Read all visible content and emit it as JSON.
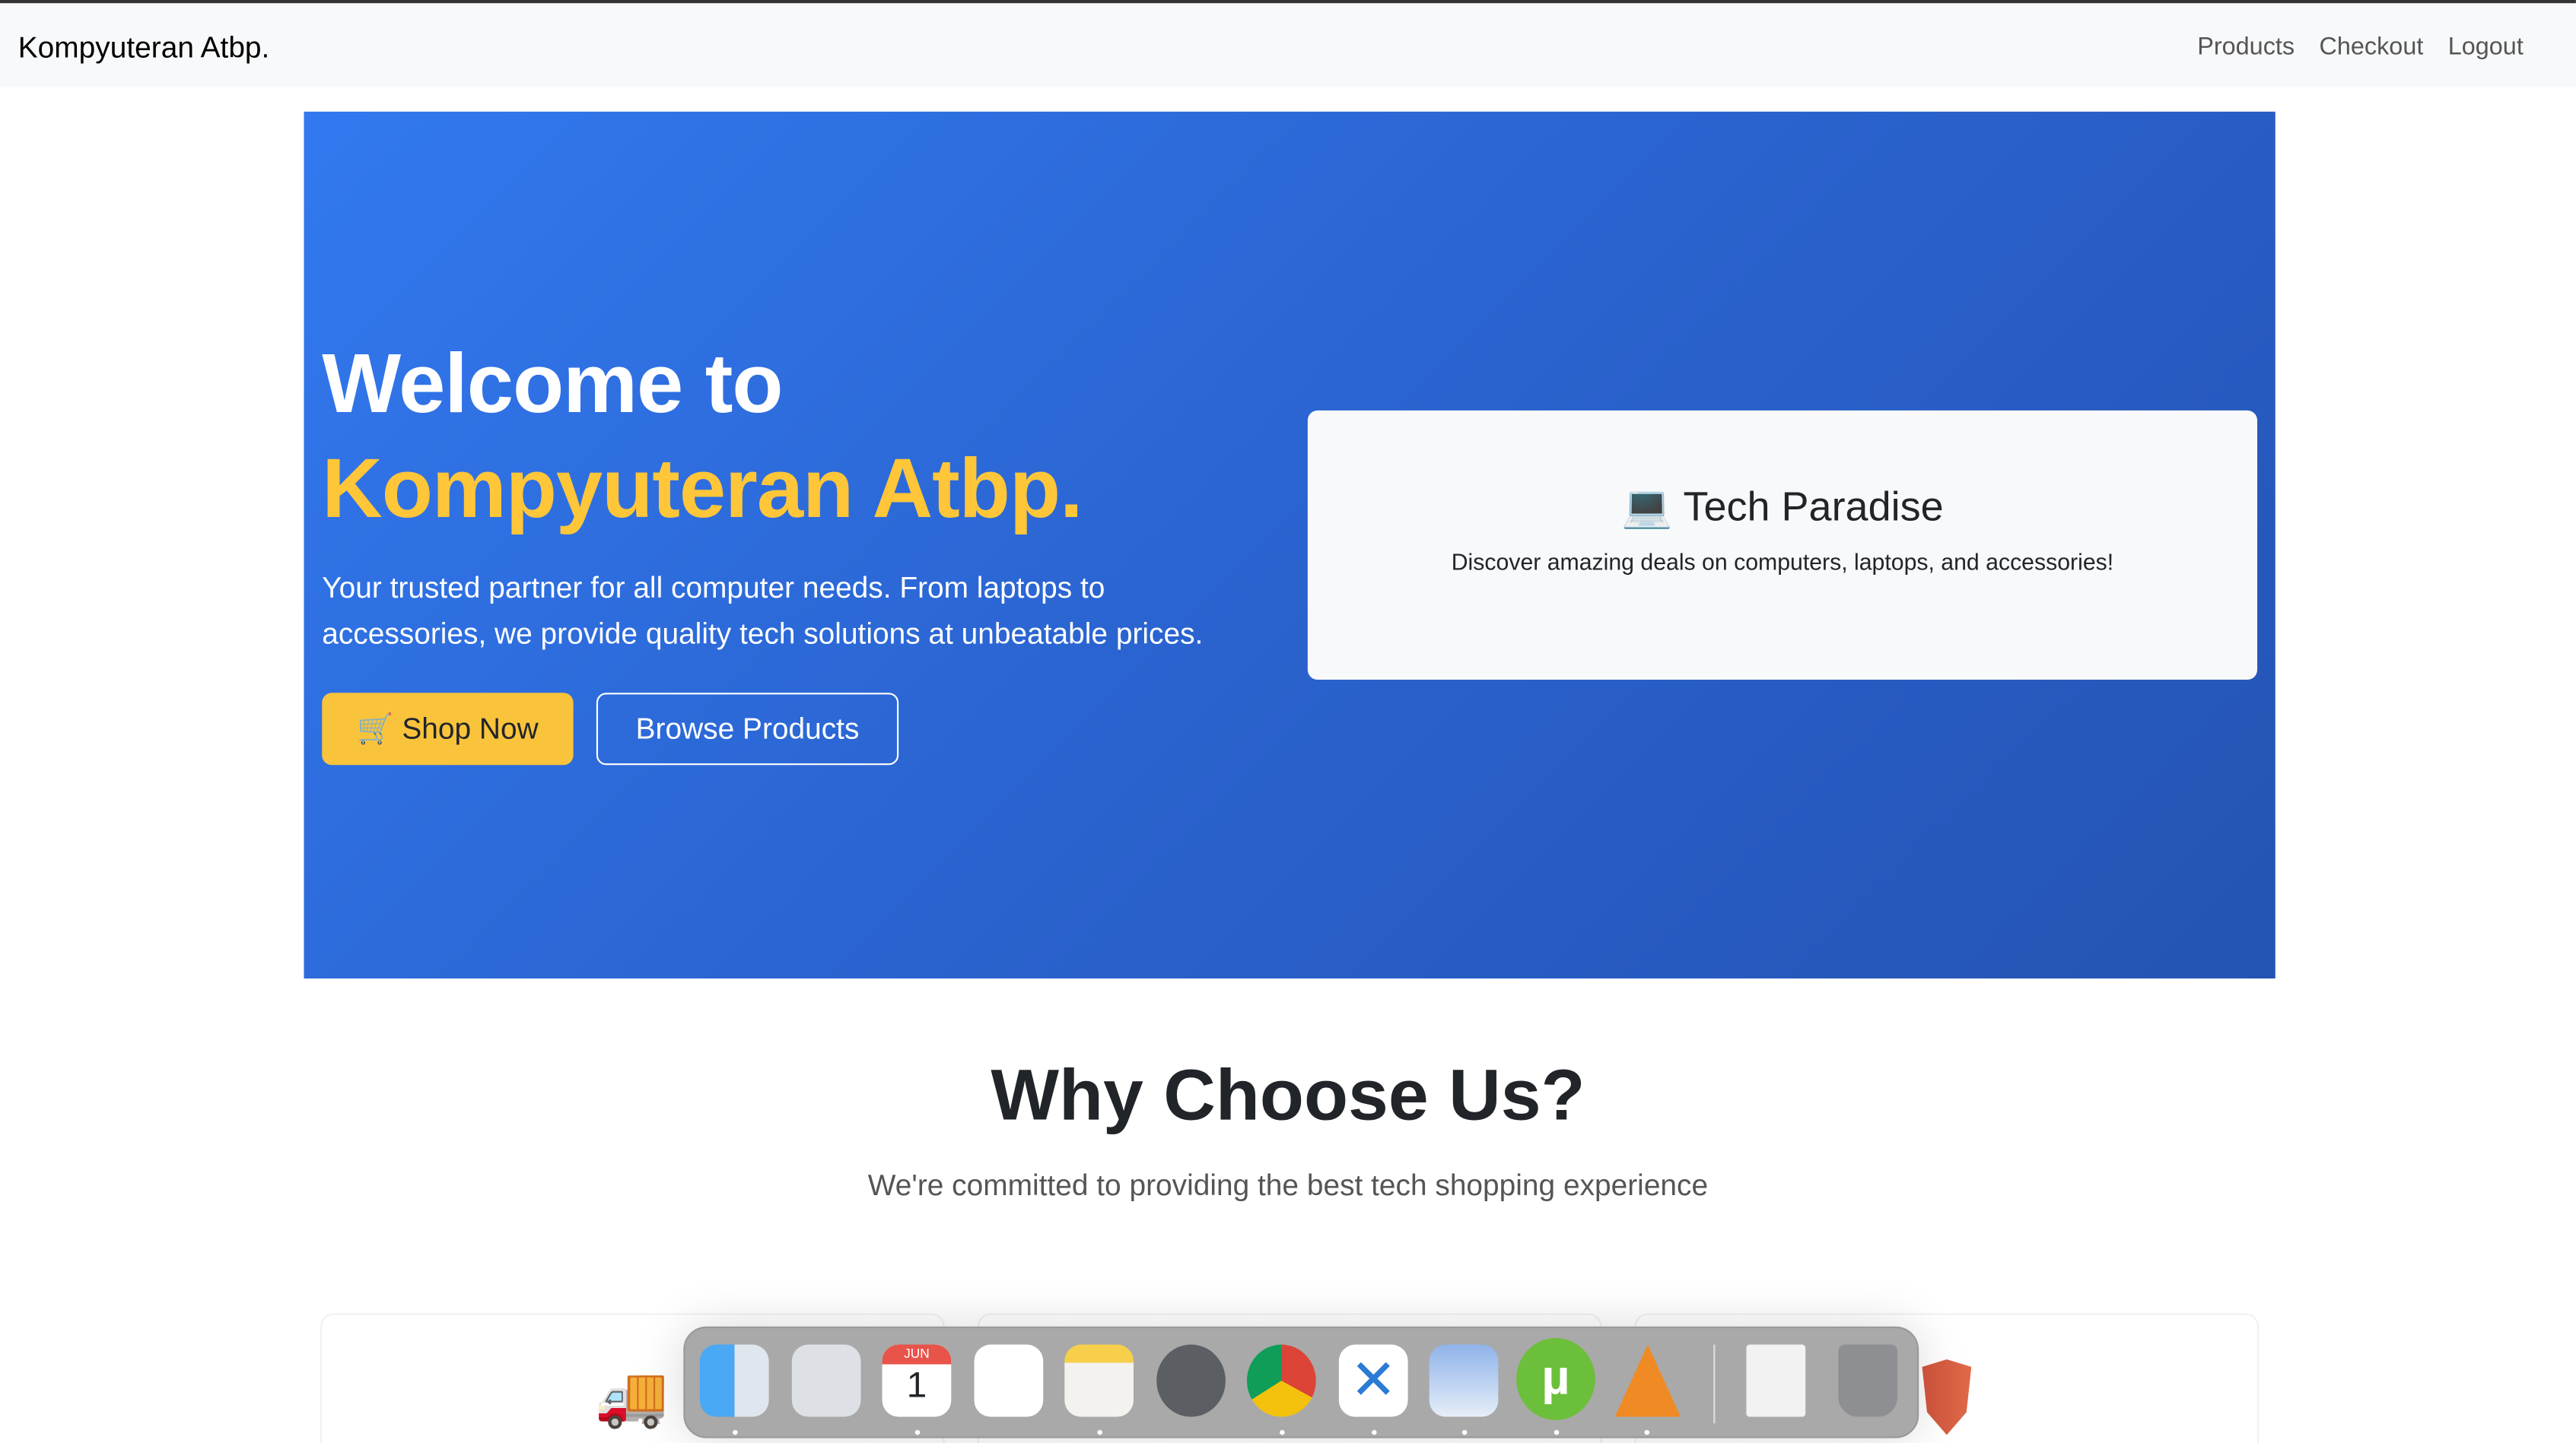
{
  "navbar": {
    "brand": "Kompyuteran Atbp.",
    "links": [
      "Products",
      "Checkout",
      "Logout"
    ]
  },
  "hero": {
    "title_line1": "Welcome to",
    "title_line2": "Kompyuteran Atbp.",
    "lead": "Your trusted partner for all computer needs. From laptops to accessories, we provide quality tech solutions at unbeatable prices.",
    "shop_button": "🛒 Shop Now",
    "browse_button": "Browse Products",
    "card_title": "💻 Tech Paradise",
    "card_text": "Discover amazing deals on computers, laptops, and accessories!"
  },
  "section": {
    "title": "Why Choose Us?",
    "subtitle": "We're committed to providing the best tech shopping experience"
  },
  "dock": {
    "calendar_month": "JUN",
    "calendar_day": "1",
    "apps": [
      "finder",
      "launchpad",
      "calendar",
      "reminders",
      "notes",
      "system-settings",
      "chrome",
      "vscode",
      "preview",
      "utorrent",
      "vlc",
      "file",
      "trash"
    ]
  },
  "colors": {
    "hero_start": "#3279ef",
    "hero_end": "#2553b3",
    "accent_yellow": "#ffc63a"
  }
}
